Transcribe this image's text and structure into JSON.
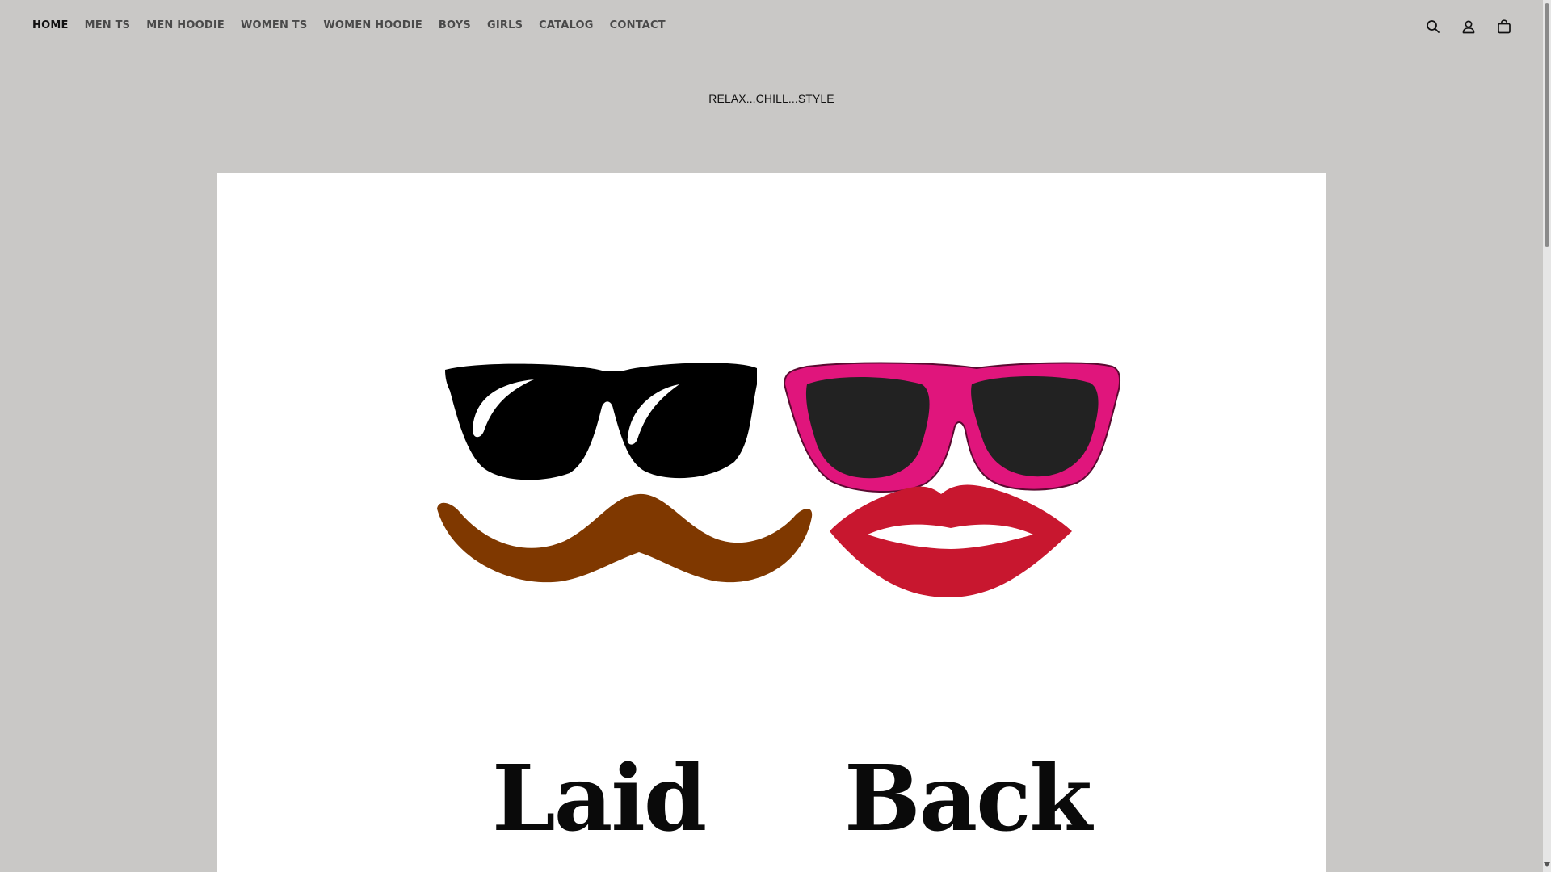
{
  "nav": {
    "items": [
      {
        "label": "HOME",
        "active": true
      },
      {
        "label": "MEN TS",
        "active": false
      },
      {
        "label": "MEN HOODIE",
        "active": false
      },
      {
        "label": "WOMEN TS",
        "active": false
      },
      {
        "label": "WOMEN HOODIE",
        "active": false
      },
      {
        "label": "BOYS",
        "active": false
      },
      {
        "label": "GIRLS",
        "active": false
      },
      {
        "label": "CATALOG",
        "active": false
      },
      {
        "label": "CONTACT",
        "active": false
      }
    ]
  },
  "header_icons": [
    "search-icon",
    "account-icon",
    "cart-icon"
  ],
  "tagline": "RELAX...CHILL...STYLE",
  "hero": {
    "word_left": "Laid",
    "word_right": "Back",
    "colors": {
      "background": "#ffffff",
      "men_glasses": "#000000",
      "mustache": "#7f3800",
      "women_frame": "#e0157c",
      "women_lens": "#222222",
      "lips": "#c8172f"
    }
  },
  "colors": {
    "page_background": "#c9c8c6",
    "nav_text": "#4a4a4a",
    "nav_active": "#111111"
  }
}
